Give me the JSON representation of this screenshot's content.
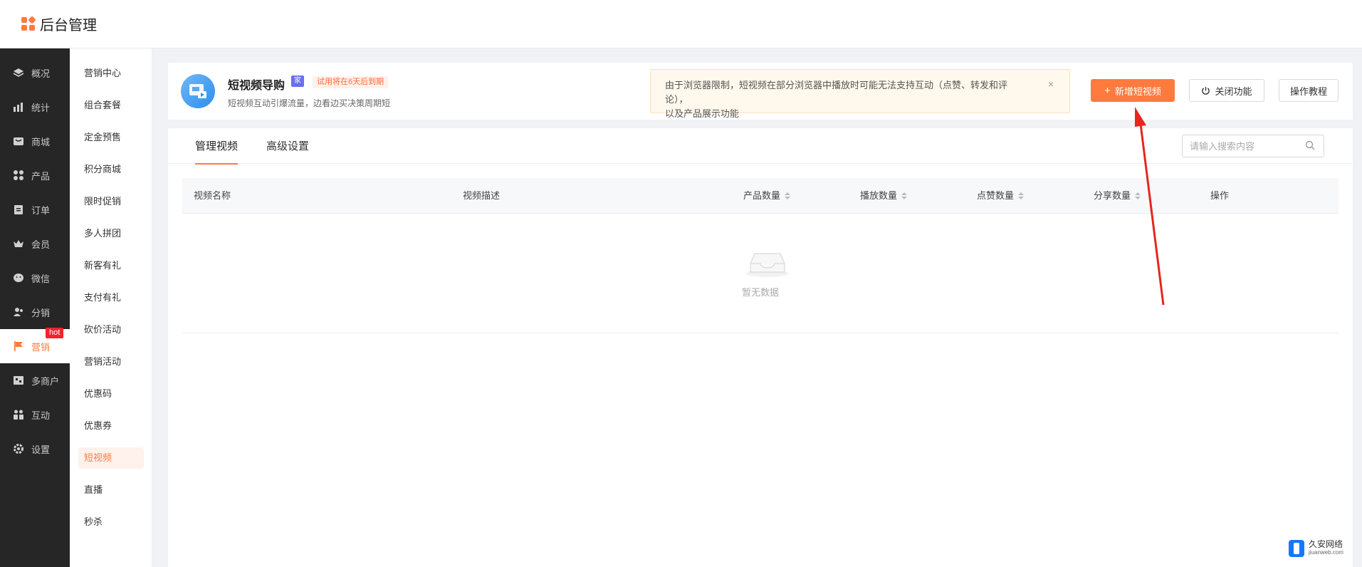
{
  "brand": {
    "title": "后台管理"
  },
  "sidebar": {
    "items": [
      {
        "label": "概况",
        "icon": "layers-icon"
      },
      {
        "label": "统计",
        "icon": "chart-icon"
      },
      {
        "label": "商城",
        "icon": "shop-icon"
      },
      {
        "label": "产品",
        "icon": "grid-icon"
      },
      {
        "label": "订单",
        "icon": "clipboard-icon"
      },
      {
        "label": "会员",
        "icon": "crown-icon"
      },
      {
        "label": "微信",
        "icon": "wechat-icon"
      },
      {
        "label": "分销",
        "icon": "users-icon"
      },
      {
        "label": "营销",
        "icon": "flag-icon",
        "active": true
      },
      {
        "label": "多商户",
        "icon": "store-icon"
      },
      {
        "label": "互动",
        "icon": "group-icon"
      },
      {
        "label": "设置",
        "icon": "gear-icon"
      }
    ],
    "hot_badge": "hot"
  },
  "subnav": {
    "items": [
      "营销中心",
      "组合套餐",
      "定金预售",
      "积分商城",
      "限时促销",
      "多人拼团",
      "新客有礼",
      "支付有礼",
      "砍价活动",
      "营销活动",
      "优惠码",
      "优惠券",
      "短视频",
      "直播",
      "秒杀"
    ],
    "active_index": 12
  },
  "header": {
    "title": "短视频导购",
    "vip_badge": "家",
    "trial_badge": "试用将在6天后到期",
    "subtitle": "短视频互动引爆流量，边看边买决策周期短",
    "notice_line1": "由于浏览器限制，短视频在部分浏览器中播放时可能无法支持互动（点赞、转发和评论），",
    "notice_line2": "以及产品展示功能",
    "notice_close": "×",
    "add_button": "新增短视频",
    "add_plus": "+",
    "close_feature_button": "关闭功能",
    "tutorial_button": "操作教程"
  },
  "tabs": [
    "管理视频",
    "高级设置"
  ],
  "search": {
    "placeholder": "请输入搜索内容"
  },
  "table": {
    "columns": [
      "视频名称",
      "视频描述",
      "产品数量",
      "播放数量",
      "点赞数量",
      "分享数量",
      "操作"
    ],
    "empty_text": "暂无数据"
  },
  "watermark": {
    "name": "久安网络",
    "domain": "jiuanweb.com"
  },
  "colors": {
    "accent": "#ff7a3d",
    "sidebar_bg": "#262626",
    "annotation_arrow": "#e8251e"
  }
}
